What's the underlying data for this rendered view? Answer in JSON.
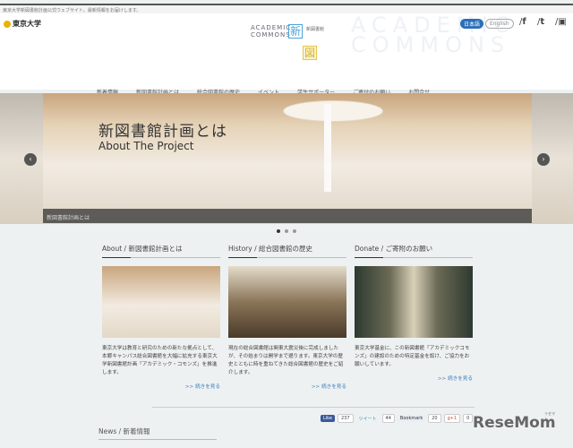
{
  "topbar": {
    "text": "東京大学新図書館計画公式ウェブサイト。最新情報をお届けします。"
  },
  "header": {
    "univ_logo": "東京大学",
    "site_logo_line1": "ACADEMIC",
    "site_logo_line2": "COMMONS",
    "logo_char1": "新",
    "logo_char2": "図",
    "logo_sub": "新図書館",
    "ghost_line1": "ACADEMIC",
    "ghost_line2": "COMMONS",
    "lang_ja": "日本語",
    "lang_en": "English",
    "social": [
      "f",
      "t",
      "▣"
    ]
  },
  "nav": [
    "新着情報",
    "新図書館計画とは",
    "総合図書館の歴史",
    "イベント",
    "学生サポーター",
    "ご寄付のお願い",
    "お問合せ"
  ],
  "hero": {
    "title": "新図書館計画とは",
    "subtitle": "About The Project",
    "caption": "新図書館計画とは",
    "prev": "‹",
    "next": "›"
  },
  "columns": [
    {
      "title": "About / 新図書館計画とは",
      "text": "東京大学は教育と研究のための新たな拠点として、本郷キャンパス総合図書館を大幅に拡充する東京大学新図書館計画「アカデミック・コモンズ」を推進します。",
      "more": ">> 続きを見る"
    },
    {
      "title": "History / 総合図書館の歴史",
      "text": "現在の総合図書館は関東大震災後に完成しましたが、その始まりは開学まで遡ります。東京大学の歴史とともに時を重ねてきた総合図書館の歴史をご紹介します。",
      "more": ">> 続きを見る"
    },
    {
      "title": "Donate / ご寄附のお願い",
      "text": "東京大学基金に、この新図書館「アカデミックコモンズ」の建設のための特定基金を設け、ご協力をお願いしています。",
      "more": ">> 続きを見る"
    }
  ],
  "share": {
    "like": "Like",
    "like_count": "237",
    "tweet": "ツイート",
    "tweet_count": "44",
    "bookmark": "Bookmark",
    "bookmark_count": "20",
    "gplus": "g+1",
    "gplus_count": "0"
  },
  "news": {
    "title": "News / 新着情報"
  },
  "watermark": "ReseMom",
  "watermark_sub": "リセマム"
}
